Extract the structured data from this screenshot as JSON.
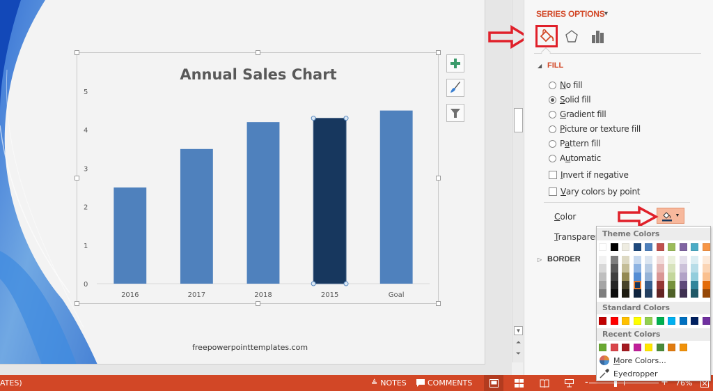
{
  "slide": {
    "footer_text": "freepowerpointtemplates.com"
  },
  "chart_data": {
    "type": "bar",
    "title": "Annual Sales Chart",
    "categories": [
      "2016",
      "2017",
      "2018",
      "2015",
      "Goal"
    ],
    "values": [
      2.5,
      3.5,
      4.2,
      4.3,
      4.5
    ],
    "yticks": [
      "0",
      "1",
      "2",
      "3",
      "4",
      "5"
    ],
    "ylim": [
      0,
      5
    ],
    "xlabel": "",
    "ylabel": "",
    "grid": false,
    "legend": "none",
    "bar_color": "#4f81bd",
    "selected_index": 3,
    "selected_color": "#17375e"
  },
  "chart_buttons": [
    {
      "name": "chart-elements",
      "icon": "plus-icon"
    },
    {
      "name": "chart-styles",
      "icon": "paintbrush-icon"
    },
    {
      "name": "chart-filters",
      "icon": "filter-icon"
    }
  ],
  "pane": {
    "title": "SERIES OPTIONS",
    "tabs": [
      "Fill & Line",
      "Effects",
      "Series Options"
    ],
    "fill_header": "FILL",
    "fill_options": [
      {
        "label": "No fill",
        "ul": "N",
        "rest": "o fill",
        "checked": false
      },
      {
        "label": "Solid fill",
        "ul": "S",
        "rest": "olid fill",
        "checked": true
      },
      {
        "label": "Gradient fill",
        "ul": "G",
        "rest": "radient fill",
        "checked": false
      },
      {
        "label": "Picture or texture fill",
        "ul": "P",
        "rest": "icture or texture fill",
        "checked": false
      },
      {
        "label": "Pattern fill",
        "pre": "P",
        "ul": "a",
        "rest": "ttern fill",
        "checked": false
      },
      {
        "label": "Automatic",
        "pre": "A",
        "ul": "u",
        "rest": "tomatic",
        "checked": false
      }
    ],
    "checkboxes": [
      {
        "label": "Invert if negative",
        "ul": "I",
        "rest": "nvert if negative",
        "checked": false
      },
      {
        "label": "Vary colors by point",
        "ul": "V",
        "rest": "ary colors by point",
        "checked": false
      }
    ],
    "color_label_ul": "C",
    "color_label_rest": "olor",
    "transparency_label_ul": "T",
    "transparency_label_rest": "ransparency",
    "border_header": "BORDER"
  },
  "color_dropdown": {
    "theme_header": "Theme Colors",
    "theme_top": [
      "#ffffff",
      "#000000",
      "#eeece1",
      "#1f497d",
      "#4f81bd",
      "#c0504d",
      "#9bbb59",
      "#8064a2",
      "#4bacc6",
      "#f79646"
    ],
    "theme_shades": [
      [
        "#f2f2f2",
        "#d8d8d8",
        "#bfbfbf",
        "#a5a5a5",
        "#7f7f7f"
      ],
      [
        "#7f7f7f",
        "#595959",
        "#3f3f3f",
        "#262626",
        "#0c0c0c"
      ],
      [
        "#ddd9c3",
        "#c4bd97",
        "#938953",
        "#494429",
        "#1d1b10"
      ],
      [
        "#c6d9f0",
        "#8db3e2",
        "#548dd4",
        "#17365d",
        "#0f243e"
      ],
      [
        "#dbe5f1",
        "#b8cce4",
        "#95b3d7",
        "#366092",
        "#244061"
      ],
      [
        "#f2dcdb",
        "#e5b9b7",
        "#d99694",
        "#953734",
        "#632423"
      ],
      [
        "#ebf1dd",
        "#d7e3bc",
        "#c3d69b",
        "#76923c",
        "#4f6128"
      ],
      [
        "#e5e0ec",
        "#ccc1d9",
        "#b2a2c7",
        "#5f497a",
        "#3f3151"
      ],
      [
        "#dbeef3",
        "#b7dde8",
        "#92cddc",
        "#31859b",
        "#205867"
      ],
      [
        "#fdeada",
        "#fbd5b5",
        "#fac08f",
        "#e36c09",
        "#974806"
      ]
    ],
    "selected_swatch": {
      "column": 3,
      "row": 3
    },
    "standard_header": "Standard Colors",
    "standard": [
      "#c00000",
      "#ff0000",
      "#ffc000",
      "#ffff00",
      "#92d050",
      "#00b050",
      "#00b0f0",
      "#0070c0",
      "#002060",
      "#7030a0"
    ],
    "recent_header": "Recent Colors",
    "recent": [
      "#6aa832",
      "#d9454a",
      "#a31a20",
      "#c0209a",
      "#ffe600",
      "#4a8a3a",
      "#e07b10",
      "#f0920a"
    ],
    "more_colors_ul": "M",
    "more_colors_rest": "ore Colors...",
    "eyedropper": "Eyedropper"
  },
  "status_bar": {
    "title_fragment": "ATES)",
    "notes": "NOTES",
    "comments": "COMMENTS",
    "zoom_minus": "-",
    "zoom_plus": "+",
    "zoom_level": "76%",
    "views": [
      "Normal",
      "Slide Sorter",
      "Reading View",
      "Slide Show"
    ]
  },
  "annotations": {
    "color": "#e0202a"
  }
}
